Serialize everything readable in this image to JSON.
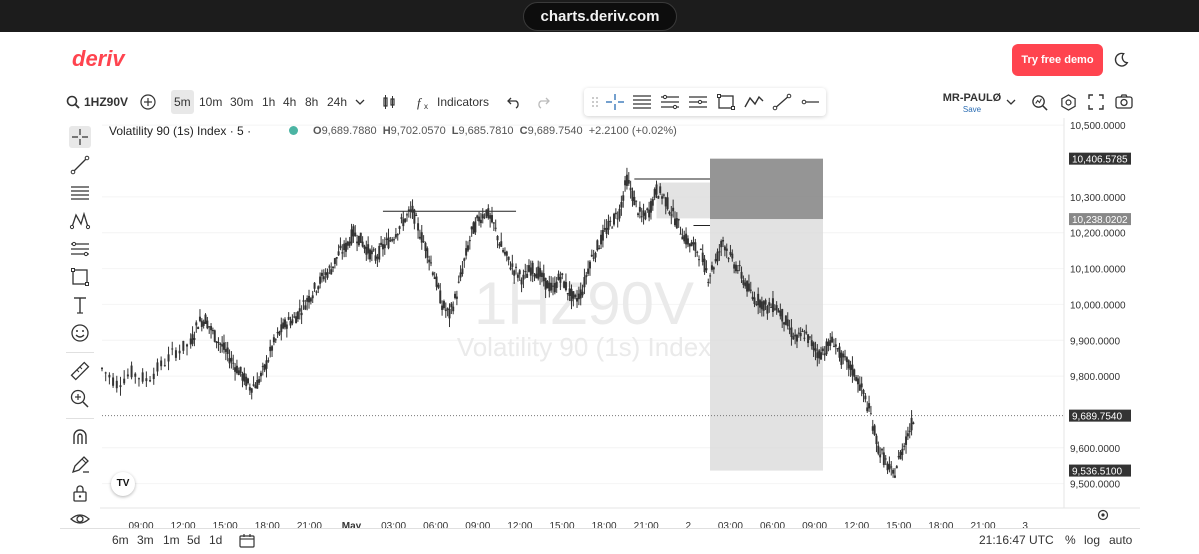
{
  "browser": {
    "url": "charts.deriv.com"
  },
  "header": {
    "logo": "deriv",
    "demo_button": "Try free demo",
    "theme_icon": "moon-icon"
  },
  "toolbar": {
    "symbol": "1HZ90V",
    "timeframes": [
      "5m",
      "10m",
      "30m",
      "1h",
      "4h",
      "8h",
      "24h"
    ],
    "active_timeframe": "5m",
    "indicators": "Indicators"
  },
  "user": {
    "name": "MR-PAULØ",
    "action": "Save"
  },
  "chart": {
    "title": "Volatility 90 (1s) Index · 5 ·",
    "ohlc": {
      "o_label": "O",
      "o": "9,689.7880",
      "h_label": "H",
      "h": "9,702.0570",
      "l_label": "L",
      "l": "9,685.7810",
      "c_label": "C",
      "c": "9,689.7540",
      "change": "+2.2100 (+0.02%)"
    },
    "watermark_symbol": "1HZ90V",
    "watermark_name": "Volatility 90 (1s) Index",
    "tv_badge": "TV"
  },
  "chart_data": {
    "type": "candlestick",
    "symbol": "1HZ90V",
    "y_ticks": [
      "10,500.0000",
      "10,300.0000",
      "10,200.0000",
      "10,100.0000",
      "10,000.0000",
      "9,900.0000",
      "9,800.0000",
      "9,600.0000",
      "9,500.0000"
    ],
    "y_tick_values": [
      10500,
      10300,
      10200,
      10100,
      10000,
      9900,
      9800,
      9600,
      9500
    ],
    "y_range": [
      9460,
      10520
    ],
    "price_badges": [
      {
        "label": "10,406.5785",
        "value": 10406.5785,
        "style": "dark"
      },
      {
        "label": "10,238.0202",
        "value": 10238.0202,
        "style": "grey"
      },
      {
        "label": "9,689.7540",
        "value": 9689.754,
        "style": "dark"
      },
      {
        "label": "9,536.5100",
        "value": 9536.51,
        "style": "dark"
      }
    ],
    "x_ticks": [
      "09:00",
      "12:00",
      "15:00",
      "18:00",
      "21:00",
      "May",
      "03:00",
      "06:00",
      "09:00",
      "12:00",
      "15:00",
      "18:00",
      "21:00",
      "2",
      "03:00",
      "06:00",
      "09:00",
      "12:00",
      "15:00",
      "18:00",
      "21:00",
      "3"
    ],
    "price_path": [
      [
        0,
        9820
      ],
      [
        2,
        9780
      ],
      [
        4,
        9810
      ],
      [
        6,
        9790
      ],
      [
        8,
        9830
      ],
      [
        10,
        9870
      ],
      [
        12,
        9890
      ],
      [
        13,
        9950
      ],
      [
        14,
        9960
      ],
      [
        15,
        9920
      ],
      [
        16,
        9890
      ],
      [
        17,
        9860
      ],
      [
        18,
        9830
      ],
      [
        19,
        9800
      ],
      [
        20,
        9770
      ],
      [
        21,
        9780
      ],
      [
        22,
        9820
      ],
      [
        23,
        9880
      ],
      [
        24,
        9920
      ],
      [
        25,
        9950
      ],
      [
        26,
        9960
      ],
      [
        27,
        9990
      ],
      [
        28,
        10020
      ],
      [
        29,
        10050
      ],
      [
        30,
        10080
      ],
      [
        31,
        10100
      ],
      [
        32,
        10140
      ],
      [
        33,
        10160
      ],
      [
        34,
        10200
      ],
      [
        35,
        10180
      ],
      [
        36,
        10150
      ],
      [
        37,
        10130
      ],
      [
        38,
        10160
      ],
      [
        39,
        10180
      ],
      [
        40,
        10210
      ],
      [
        41,
        10240
      ],
      [
        42,
        10260
      ],
      [
        43,
        10200
      ],
      [
        44,
        10150
      ],
      [
        45,
        10080
      ],
      [
        46,
        10000
      ],
      [
        47,
        9970
      ],
      [
        48,
        10030
      ],
      [
        49,
        10120
      ],
      [
        50,
        10200
      ],
      [
        51,
        10240
      ],
      [
        52,
        10260
      ],
      [
        53,
        10220
      ],
      [
        54,
        10160
      ],
      [
        55,
        10120
      ],
      [
        56,
        10090
      ],
      [
        57,
        10070
      ],
      [
        58,
        10100
      ],
      [
        59,
        10090
      ],
      [
        60,
        10060
      ],
      [
        61,
        10040
      ],
      [
        62,
        10080
      ],
      [
        63,
        10040
      ],
      [
        64,
        10010
      ],
      [
        65,
        10040
      ],
      [
        66,
        10120
      ],
      [
        67,
        10160
      ],
      [
        68,
        10200
      ],
      [
        69,
        10230
      ],
      [
        70,
        10260
      ],
      [
        71,
        10350
      ],
      [
        72,
        10290
      ],
      [
        73,
        10240
      ],
      [
        74,
        10260
      ],
      [
        75,
        10320
      ],
      [
        76,
        10300
      ],
      [
        77,
        10260
      ],
      [
        78,
        10220
      ],
      [
        79,
        10180
      ],
      [
        80,
        10160
      ],
      [
        81,
        10140
      ],
      [
        82,
        10080
      ],
      [
        83,
        10120
      ],
      [
        84,
        10180
      ],
      [
        85,
        10130
      ],
      [
        86,
        10100
      ],
      [
        87,
        10060
      ],
      [
        88,
        10020
      ],
      [
        89,
        10010
      ],
      [
        90,
        9990
      ],
      [
        91,
        10000
      ],
      [
        92,
        9970
      ],
      [
        93,
        9930
      ],
      [
        94,
        9900
      ],
      [
        95,
        9920
      ],
      [
        96,
        9890
      ],
      [
        97,
        9860
      ],
      [
        98,
        9880
      ],
      [
        99,
        9900
      ],
      [
        100,
        9850
      ],
      [
        101,
        9830
      ],
      [
        102,
        9800
      ],
      [
        103,
        9750
      ],
      [
        104,
        9690
      ],
      [
        105,
        9600
      ],
      [
        106,
        9560
      ],
      [
        107,
        9520
      ],
      [
        108,
        9580
      ],
      [
        109,
        9640
      ],
      [
        110,
        9690
      ]
    ],
    "current_price": 9689.754,
    "drawings": [
      {
        "type": "line",
        "label": "peak-line",
        "from": [
          38,
          10260
        ],
        "to": [
          56,
          10260
        ]
      },
      {
        "type": "line",
        "label": "top-line",
        "from": [
          72,
          10350
        ],
        "to": [
          121,
          10350
        ]
      },
      {
        "type": "line",
        "label": "mid-line",
        "from": [
          80,
          10220
        ],
        "to": [
          121,
          10220
        ]
      },
      {
        "type": "position-box",
        "entry": 10238.0202,
        "target": 10406.5785,
        "stop": 9536.51
      }
    ],
    "grid": true,
    "ylabel": "",
    "xlabel": ""
  },
  "bottombar": {
    "ranges": [
      "6m",
      "3m",
      "1m",
      "5d",
      "1d"
    ],
    "time": "21:16:47 UTC",
    "percent": "%",
    "log": "log",
    "auto": "auto"
  }
}
